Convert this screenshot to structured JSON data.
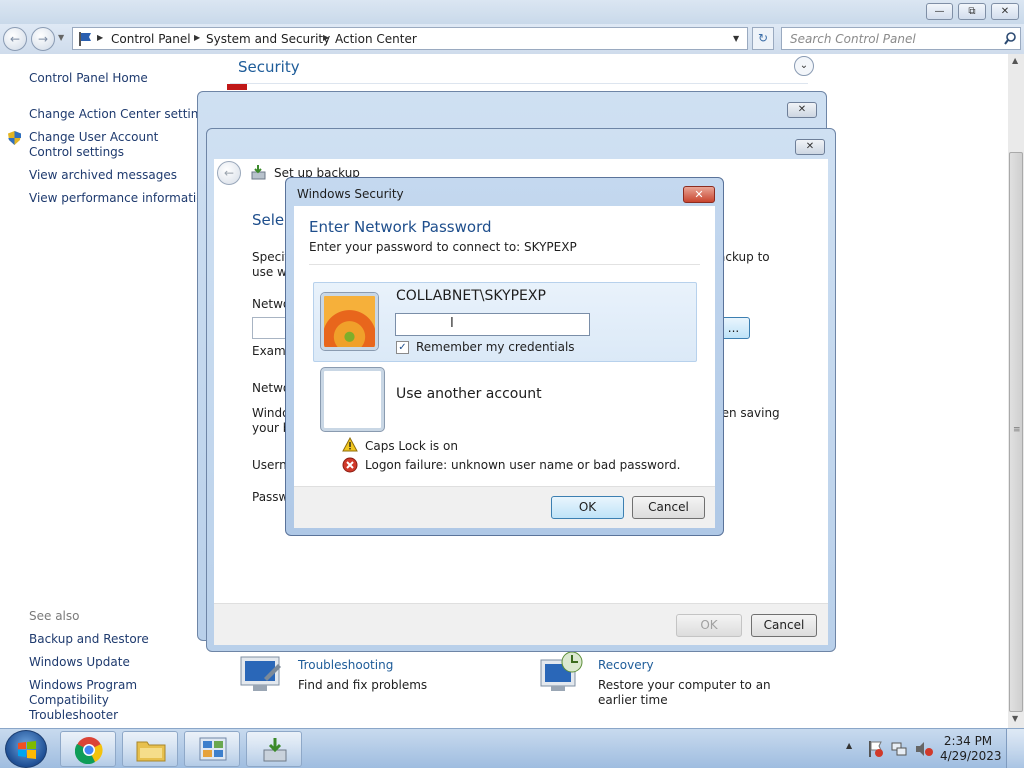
{
  "window": {
    "minimize_icon": "minimize-icon",
    "maximize_icon": "restore-icon",
    "close_icon": "close-icon"
  },
  "address": {
    "breadcrumbs": [
      "Control Panel",
      "System and Security",
      "Action Center"
    ],
    "search_placeholder": "Search Control Panel"
  },
  "leftnav": {
    "items": [
      "Control Panel Home",
      "Change Action Center settings",
      "Change User Account Control settings",
      "View archived messages",
      "View performance information"
    ],
    "see_also_heading": "See also",
    "see_also": [
      "Backup and Restore",
      "Windows Update",
      "Windows Program Compatibility Troubleshooter"
    ]
  },
  "main": {
    "section_title": "Security",
    "troubleshooting": {
      "title": "Troubleshooting",
      "desc": "Find and fix problems"
    },
    "recovery": {
      "title": "Recovery",
      "desc": "Restore your computer to an earlier time"
    }
  },
  "backup": {
    "title": "Set up backup",
    "heading_partial": "Selec",
    "spec_text_1": "Specif",
    "spec_text_2": "use wh",
    "right_text": "ackup to",
    "network_label": "Netwo",
    "example_label": "Examp",
    "network_label_2": "Netwo",
    "windows_text_1": "Windo",
    "windows_text_2": "your b",
    "windows_right": "hen saving",
    "username_label": "Userna",
    "password_label": "Passw",
    "browse_btn_partial": "...",
    "ok_label": "OK",
    "cancel_label": "Cancel"
  },
  "security_dialog": {
    "title": "Windows Security",
    "heading": "Enter Network Password",
    "subtitle": "Enter your password to connect to: SKYPEXP",
    "account_name": "COLLABNET\\SKYPEXP",
    "password_value": "",
    "remember_label": "Remember my credentials",
    "remember_checked": true,
    "other_account_label": "Use another account",
    "caps_lock_msg": "Caps Lock is on",
    "logon_failure_msg": "Logon failure: unknown user name or bad password.",
    "ok_label": "OK",
    "cancel_label": "Cancel"
  },
  "taskbar": {
    "time": "2:34 PM",
    "date": "4/29/2023"
  },
  "colors": {
    "link": "#1e5c99",
    "nav_link": "#1e3a6e",
    "dialog_heading": "#1e4e8c",
    "close_red": "#c8452f"
  }
}
